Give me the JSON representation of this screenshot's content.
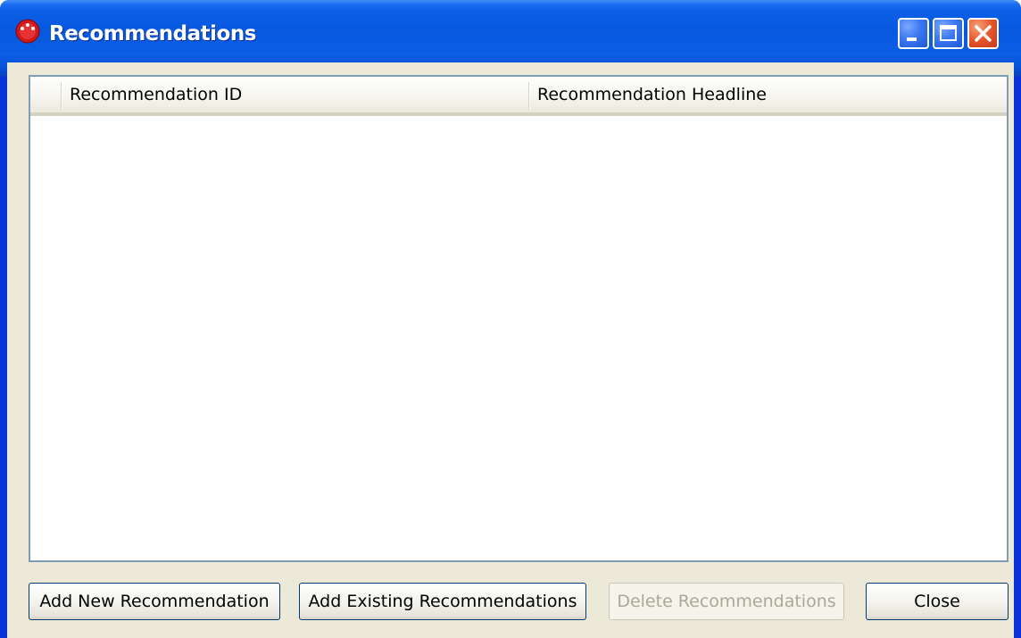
{
  "window": {
    "title": "Recommendations",
    "controls": [
      "minimize-icon",
      "maximize-icon",
      "close-icon"
    ],
    "colors": {
      "titlebar": "#0858e0",
      "close": "#e5562a",
      "client": "#ece9d8"
    }
  },
  "list": {
    "columns": [
      "Recommendation ID",
      "Recommendation Headline"
    ],
    "rows": []
  },
  "buttons": {
    "add_new": "Add New Recommendation",
    "add_existing": "Add Existing Recommendations",
    "delete": "Delete Recommendations",
    "close": "Close"
  }
}
